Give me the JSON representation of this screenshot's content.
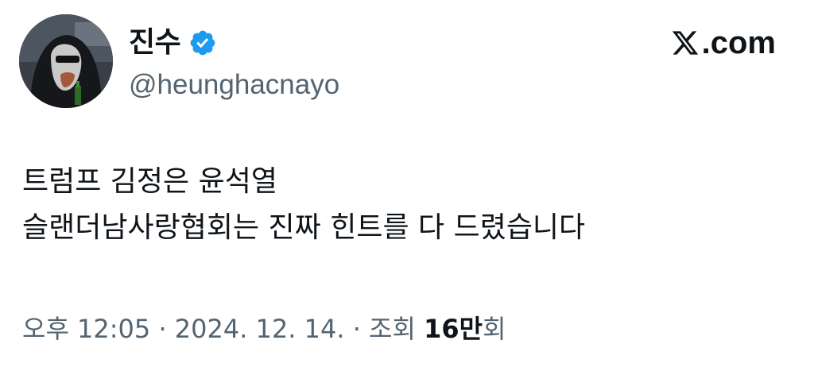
{
  "author": {
    "display_name": "진수",
    "handle": "@heunghacnayo",
    "verified": true,
    "avatar_icon": "avatar-hooded-figure-sunglasses"
  },
  "brand": {
    "label": ".com",
    "icon": "x-logo-icon"
  },
  "tweet": {
    "lines": [
      "트럼프 김정은 윤석열",
      "슬랜더남사랑협회는 진짜 힌트를 다 드렸습니다"
    ]
  },
  "meta": {
    "time": "오후 12:05",
    "sep1": " · ",
    "date": "2024. 12. 14.",
    "sep2": " · ",
    "views_label": "조회 ",
    "views_count": "16만",
    "views_suffix": "회"
  },
  "colors": {
    "text": "#0f1419",
    "muted": "#536471",
    "verified_blue": "#1d9bf0"
  }
}
